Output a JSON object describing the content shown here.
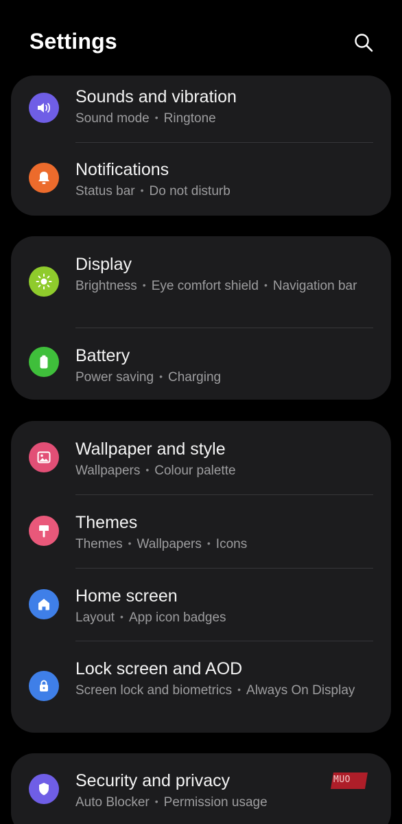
{
  "header": {
    "title": "Settings",
    "search_icon": "search-icon"
  },
  "colors": {
    "background": "#000000",
    "card": "#1c1c1e",
    "sounds": "#6f5ee6",
    "notifications": "#ec6b2c",
    "display": "#8fcb2c",
    "battery": "#3fbf3b",
    "wallpaper": "#e24f76",
    "themes": "#e9587a",
    "home": "#3f7fe8",
    "lock": "#3f7fe8",
    "security": "#6f5ee6"
  },
  "groups": [
    {
      "items": [
        {
          "icon": "speaker-icon",
          "title": "Sounds and vibration",
          "subs": [
            "Sound mode",
            "Ringtone"
          ]
        },
        {
          "icon": "bell-icon",
          "title": "Notifications",
          "subs": [
            "Status bar",
            "Do not disturb"
          ]
        }
      ]
    },
    {
      "items": [
        {
          "icon": "brightness-icon",
          "title": "Display",
          "subs": [
            "Brightness",
            "Eye comfort shield",
            "Navigation bar"
          ]
        },
        {
          "icon": "battery-icon",
          "title": "Battery",
          "subs": [
            "Power saving",
            "Charging"
          ]
        }
      ]
    },
    {
      "items": [
        {
          "icon": "image-icon",
          "title": "Wallpaper and style",
          "subs": [
            "Wallpapers",
            "Colour palette"
          ]
        },
        {
          "icon": "paint-brush-icon",
          "title": "Themes",
          "subs": [
            "Themes",
            "Wallpapers",
            "Icons"
          ]
        },
        {
          "icon": "home-icon",
          "title": "Home screen",
          "subs": [
            "Layout",
            "App icon badges"
          ]
        },
        {
          "icon": "lock-icon",
          "title": "Lock screen and AOD",
          "subs": [
            "Screen lock and biometrics",
            "Always On Display"
          ]
        }
      ]
    },
    {
      "items": [
        {
          "icon": "shield-icon",
          "title": "Security and privacy",
          "subs": [
            "Auto Blocker",
            "Permission usage"
          ]
        }
      ]
    }
  ],
  "watermark": {
    "text": "MUO"
  }
}
